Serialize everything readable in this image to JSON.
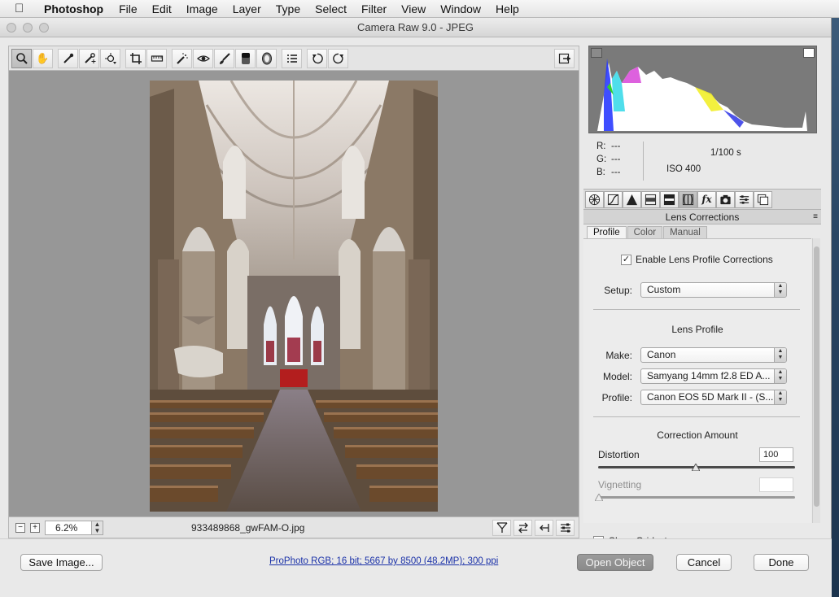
{
  "menubar": {
    "app_name": "Photoshop",
    "items": [
      "File",
      "Edit",
      "Image",
      "Layer",
      "Type",
      "Select",
      "Filter",
      "View",
      "Window",
      "Help"
    ]
  },
  "window": {
    "title": "Camera Raw 9.0  -  JPEG"
  },
  "toolbar": {
    "tools": [
      "zoom-tool",
      "hand-tool",
      "white-balance-tool",
      "color-sampler-tool",
      "targeted-adjustment-tool",
      "crop-tool",
      "straighten-tool",
      "spot-removal-tool",
      "red-eye-tool",
      "adjustment-brush-tool",
      "graduated-filter-tool",
      "radial-filter-tool",
      "preferences-tool",
      "rotate-left-tool",
      "rotate-right-tool"
    ],
    "selected": "zoom-tool"
  },
  "status": {
    "zoom_value": "6.2%",
    "filename": "933489868_gwFAM-O.jpg"
  },
  "readout": {
    "r_label": "R:",
    "r_value": "---",
    "g_label": "G:",
    "g_value": "---",
    "b_label": "B:",
    "b_value": "---",
    "shutter": "1/100 s",
    "iso": "ISO 400"
  },
  "panel": {
    "title": "Lens Corrections",
    "subtabs": [
      "Profile",
      "Color",
      "Manual"
    ],
    "selected_subtab": "Profile",
    "enable_label": "Enable Lens Profile Corrections",
    "enable_checked": true,
    "setup_label": "Setup:",
    "setup_value": "Custom",
    "lens_profile_heading": "Lens Profile",
    "make_label": "Make:",
    "make_value": "Canon",
    "model_label": "Model:",
    "model_value": "Samyang 14mm f2.8 ED A...",
    "profile_label": "Profile:",
    "profile_value": "Canon EOS 5D Mark II - (S...",
    "correction_heading": "Correction Amount",
    "distortion_label": "Distortion",
    "distortion_value": "100",
    "vignetting_label": "Vignetting",
    "vignetting_value": ""
  },
  "show_grid_label": "Show Grid",
  "footer": {
    "save_label": "Save Image...",
    "workflow_link": "ProPhoto RGB; 16 bit; 5667 by 8500 (48.2MP); 300 ppi",
    "open_object_label": "Open Object",
    "cancel_label": "Cancel",
    "done_label": "Done"
  }
}
